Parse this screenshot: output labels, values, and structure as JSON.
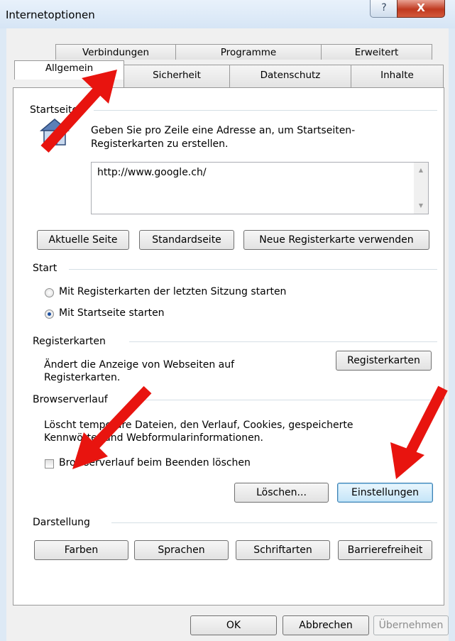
{
  "window": {
    "title": "Internetoptionen",
    "help_label": "?",
    "close_label": "X"
  },
  "tabs_back": [
    {
      "label": "Verbindungen"
    },
    {
      "label": "Programme"
    },
    {
      "label": "Erweitert"
    }
  ],
  "tabs_front": [
    {
      "label": "Allgemein",
      "active": true
    },
    {
      "label": "Sicherheit"
    },
    {
      "label": "Datenschutz"
    },
    {
      "label": "Inhalte"
    }
  ],
  "startseite": {
    "heading": "Startseite",
    "description_line1": "Geben Sie pro Zeile eine Adresse an, um Startseiten-",
    "description_line2": "Registerkarten zu erstellen.",
    "url_value": "http://www.google.ch/",
    "btn_current": "Aktuelle Seite",
    "btn_default": "Standardseite",
    "btn_newtab": "Neue Registerkarte verwenden"
  },
  "start": {
    "heading": "Start",
    "option_last_session": "Mit Registerkarten der letzten Sitzung starten",
    "option_homepage": "Mit Startseite starten",
    "selected": "homepage"
  },
  "registerkarten": {
    "heading": "Registerkarten",
    "description_line1": "Ändert die Anzeige von Webseiten auf",
    "description_line2": "Registerkarten.",
    "btn": "Registerkarten"
  },
  "browserverlauf": {
    "heading": "Browserverlauf",
    "description_line1": "Löscht temporäre Dateien, den Verlauf, Cookies, gespeicherte",
    "description_line2": "Kennwörter und Webformularinformationen.",
    "checkbox_label": "Browserverlauf beim Beenden löschen",
    "checkbox_checked": false,
    "btn_delete": "Löschen...",
    "btn_settings": "Einstellungen"
  },
  "darstellung": {
    "heading": "Darstellung",
    "btn_colors": "Farben",
    "btn_languages": "Sprachen",
    "btn_fonts": "Schriftarten",
    "btn_accessibility": "Barrierefreiheit"
  },
  "footer": {
    "ok": "OK",
    "cancel": "Abbrechen",
    "apply": "Übernehmen"
  },
  "colors": {
    "annotation_arrow": "#e8140f",
    "focus_border": "#3c7fb1"
  }
}
